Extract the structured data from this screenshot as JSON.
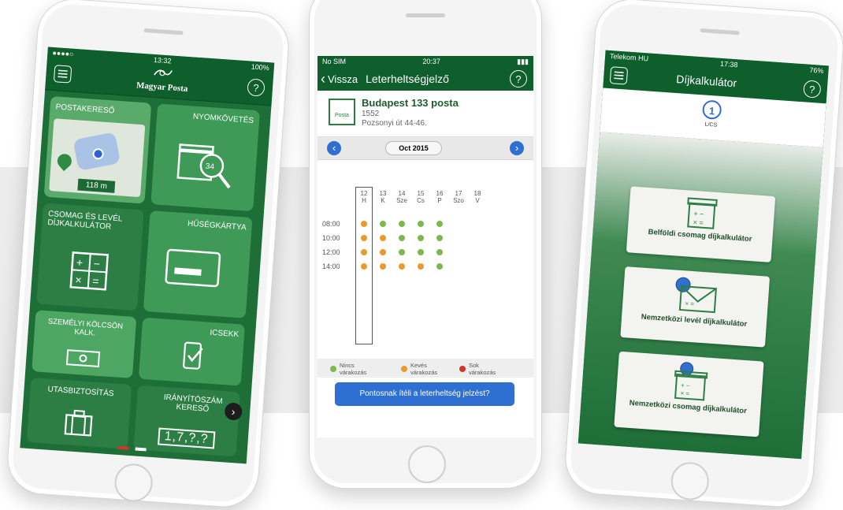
{
  "colors": {
    "brand_green": "#0f5f2d",
    "tile_green": "#3f9a57",
    "link_blue": "#2f6fd1",
    "dot_green": "#7cb84a",
    "dot_orange": "#e89a2c",
    "dot_red": "#d6332a"
  },
  "left_phone": {
    "status_time": "13:32",
    "status_battery": "100%",
    "brand": "Magyar Posta",
    "menu_icon": "hamburger-icon",
    "help_label": "?",
    "tiles": {
      "postakereso": "POSTAKERESŐ",
      "distance": "118 m",
      "nyomkovetes": "NYOMKÖVETÉS",
      "nyomkovetes_code": "34",
      "dijkalkulator": "CSOMAG ÉS LEVÉL DÍJKALKULÁTOR",
      "husegkartya": "HŰSÉGKÁRTYA",
      "szemelyi": "SZEMÉLYI KÖLCSÖN KALK.",
      "icsekk": "ICSEKK",
      "utasbiztositas": "UTASBIZTOSÍTÁS",
      "iranyitoszam": "IRÁNYÍTÓSZÁM KERESŐ",
      "iranyitoszam_code": "1,7,?,?"
    }
  },
  "middle_phone": {
    "status_carrier": "No SIM",
    "status_time": "20:37",
    "back_label": "Vissza",
    "title": "Leterheltségjelző",
    "help_label": "?",
    "post_name": "Budapest 133 posta",
    "post_zip": "1552",
    "post_address": "Pozsonyi út  44-46.",
    "month": "Oct 2015",
    "days": [
      {
        "num": "12",
        "name": "H"
      },
      {
        "num": "13",
        "name": "K"
      },
      {
        "num": "14",
        "name": "Sze"
      },
      {
        "num": "15",
        "name": "Cs"
      },
      {
        "num": "16",
        "name": "P"
      },
      {
        "num": "17",
        "name": "Szo"
      },
      {
        "num": "18",
        "name": "V"
      }
    ],
    "times": [
      "08:00",
      "10:00",
      "12:00",
      "14:00"
    ],
    "legend": {
      "green": "Nincs várakozás",
      "orange": "Kevés várakozás",
      "red": "Sok várakozás"
    },
    "button": "Pontosnak ítéli a leterheltség jelzést?"
  },
  "right_phone": {
    "status_carrier": "Telekom HU",
    "status_time": "17:38",
    "status_battery": "76%",
    "title": "Díjkalkulátor",
    "help_label": "?",
    "step_number": "1",
    "step_label": "L/CS",
    "cards": {
      "belfoldi": "Belföldi csomag díjkalkulátor",
      "nemzetkozi_level": "Nemzetközi levél díjkalkulátor",
      "nemzetkozi_csomag": "Nemzetközi csomag díjkalkulátor"
    }
  }
}
